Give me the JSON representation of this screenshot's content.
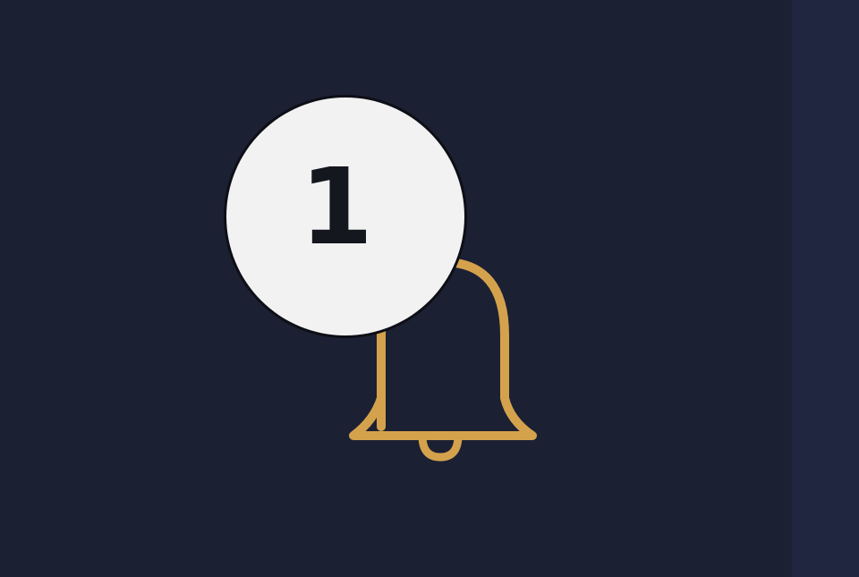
{
  "notifications": {
    "count": "1",
    "icon": "bell-icon",
    "accent_color": "#d4a24c",
    "badge_background": "#f2f2f2",
    "badge_text_color": "#15171f",
    "background_color": "#1c2033"
  }
}
